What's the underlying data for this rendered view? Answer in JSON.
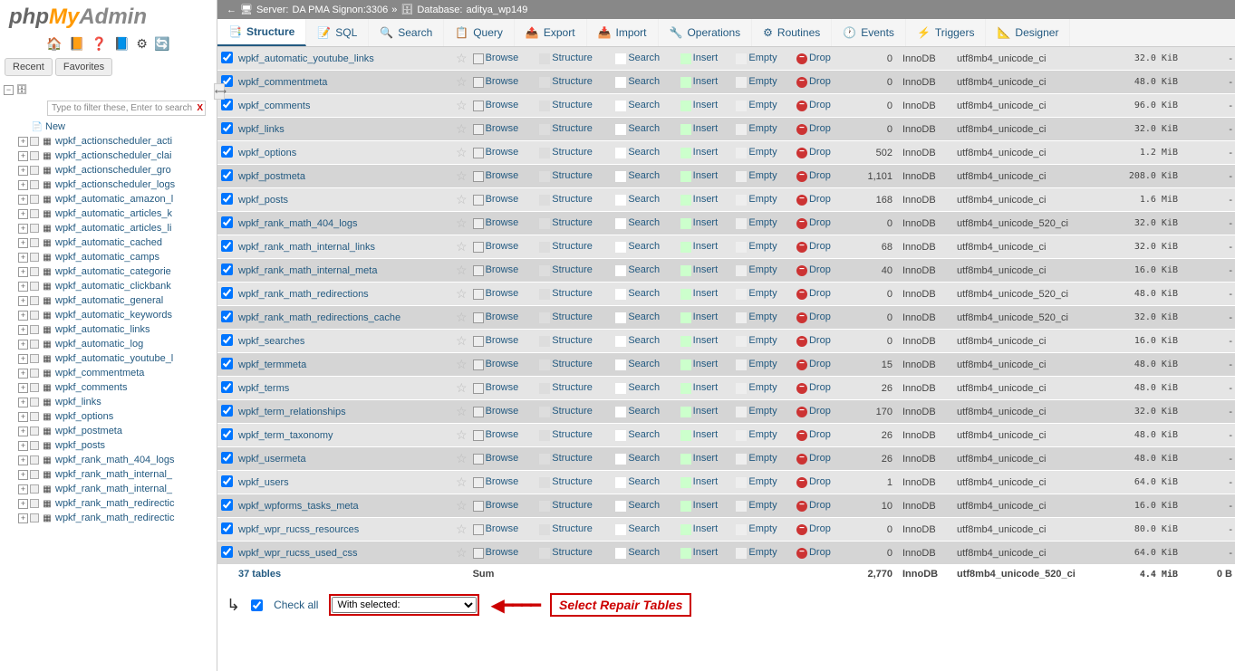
{
  "logo": {
    "php": "php",
    "my": "My",
    "admin": "Admin"
  },
  "sidebar_tabs": {
    "recent": "Recent",
    "favorites": "Favorites"
  },
  "filter_placeholder": "Type to filter these, Enter to search",
  "tree_new": "New",
  "tree_items": [
    "wpkf_actionscheduler_acti",
    "wpkf_actionscheduler_clai",
    "wpkf_actionscheduler_gro",
    "wpkf_actionscheduler_logs",
    "wpkf_automatic_amazon_l",
    "wpkf_automatic_articles_k",
    "wpkf_automatic_articles_li",
    "wpkf_automatic_cached",
    "wpkf_automatic_camps",
    "wpkf_automatic_categorie",
    "wpkf_automatic_clickbank",
    "wpkf_automatic_general",
    "wpkf_automatic_keywords",
    "wpkf_automatic_links",
    "wpkf_automatic_log",
    "wpkf_automatic_youtube_l",
    "wpkf_commentmeta",
    "wpkf_comments",
    "wpkf_links",
    "wpkf_options",
    "wpkf_postmeta",
    "wpkf_posts",
    "wpkf_rank_math_404_logs",
    "wpkf_rank_math_internal_",
    "wpkf_rank_math_internal_",
    "wpkf_rank_math_redirectic",
    "wpkf_rank_math_redirectic"
  ],
  "breadcrumb": {
    "server_label": "Server:",
    "server": "DA PMA Signon:3306",
    "db_label": "Database:",
    "db": "aditya_wp149"
  },
  "tabs": [
    "Structure",
    "SQL",
    "Search",
    "Query",
    "Export",
    "Import",
    "Operations",
    "Routines",
    "Events",
    "Triggers",
    "Designer"
  ],
  "actions": {
    "browse": "Browse",
    "structure": "Structure",
    "search": "Search",
    "insert": "Insert",
    "empty": "Empty",
    "drop": "Drop"
  },
  "tables": [
    {
      "name": "wpkf_automatic_youtube_links",
      "rows": "0",
      "engine": "InnoDB",
      "collation": "utf8mb4_unicode_ci",
      "size": "32.0 KiB",
      "overhead": "-"
    },
    {
      "name": "wpkf_commentmeta",
      "rows": "0",
      "engine": "InnoDB",
      "collation": "utf8mb4_unicode_ci",
      "size": "48.0 KiB",
      "overhead": "-"
    },
    {
      "name": "wpkf_comments",
      "rows": "0",
      "engine": "InnoDB",
      "collation": "utf8mb4_unicode_ci",
      "size": "96.0 KiB",
      "overhead": "-"
    },
    {
      "name": "wpkf_links",
      "rows": "0",
      "engine": "InnoDB",
      "collation": "utf8mb4_unicode_ci",
      "size": "32.0 KiB",
      "overhead": "-"
    },
    {
      "name": "wpkf_options",
      "rows": "502",
      "engine": "InnoDB",
      "collation": "utf8mb4_unicode_ci",
      "size": "1.2 MiB",
      "overhead": "-"
    },
    {
      "name": "wpkf_postmeta",
      "rows": "1,101",
      "engine": "InnoDB",
      "collation": "utf8mb4_unicode_ci",
      "size": "208.0 KiB",
      "overhead": "-"
    },
    {
      "name": "wpkf_posts",
      "rows": "168",
      "engine": "InnoDB",
      "collation": "utf8mb4_unicode_ci",
      "size": "1.6 MiB",
      "overhead": "-"
    },
    {
      "name": "wpkf_rank_math_404_logs",
      "rows": "0",
      "engine": "InnoDB",
      "collation": "utf8mb4_unicode_520_ci",
      "size": "32.0 KiB",
      "overhead": "-"
    },
    {
      "name": "wpkf_rank_math_internal_links",
      "rows": "68",
      "engine": "InnoDB",
      "collation": "utf8mb4_unicode_ci",
      "size": "32.0 KiB",
      "overhead": "-"
    },
    {
      "name": "wpkf_rank_math_internal_meta",
      "rows": "40",
      "engine": "InnoDB",
      "collation": "utf8mb4_unicode_ci",
      "size": "16.0 KiB",
      "overhead": "-"
    },
    {
      "name": "wpkf_rank_math_redirections",
      "rows": "0",
      "engine": "InnoDB",
      "collation": "utf8mb4_unicode_520_ci",
      "size": "48.0 KiB",
      "overhead": "-"
    },
    {
      "name": "wpkf_rank_math_redirections_cache",
      "rows": "0",
      "engine": "InnoDB",
      "collation": "utf8mb4_unicode_520_ci",
      "size": "32.0 KiB",
      "overhead": "-"
    },
    {
      "name": "wpkf_searches",
      "rows": "0",
      "engine": "InnoDB",
      "collation": "utf8mb4_unicode_ci",
      "size": "16.0 KiB",
      "overhead": "-"
    },
    {
      "name": "wpkf_termmeta",
      "rows": "15",
      "engine": "InnoDB",
      "collation": "utf8mb4_unicode_ci",
      "size": "48.0 KiB",
      "overhead": "-"
    },
    {
      "name": "wpkf_terms",
      "rows": "26",
      "engine": "InnoDB",
      "collation": "utf8mb4_unicode_ci",
      "size": "48.0 KiB",
      "overhead": "-"
    },
    {
      "name": "wpkf_term_relationships",
      "rows": "170",
      "engine": "InnoDB",
      "collation": "utf8mb4_unicode_ci",
      "size": "32.0 KiB",
      "overhead": "-"
    },
    {
      "name": "wpkf_term_taxonomy",
      "rows": "26",
      "engine": "InnoDB",
      "collation": "utf8mb4_unicode_ci",
      "size": "48.0 KiB",
      "overhead": "-"
    },
    {
      "name": "wpkf_usermeta",
      "rows": "26",
      "engine": "InnoDB",
      "collation": "utf8mb4_unicode_ci",
      "size": "48.0 KiB",
      "overhead": "-"
    },
    {
      "name": "wpkf_users",
      "rows": "1",
      "engine": "InnoDB",
      "collation": "utf8mb4_unicode_ci",
      "size": "64.0 KiB",
      "overhead": "-"
    },
    {
      "name": "wpkf_wpforms_tasks_meta",
      "rows": "10",
      "engine": "InnoDB",
      "collation": "utf8mb4_unicode_ci",
      "size": "16.0 KiB",
      "overhead": "-"
    },
    {
      "name": "wpkf_wpr_rucss_resources",
      "rows": "0",
      "engine": "InnoDB",
      "collation": "utf8mb4_unicode_ci",
      "size": "80.0 KiB",
      "overhead": "-"
    },
    {
      "name": "wpkf_wpr_rucss_used_css",
      "rows": "0",
      "engine": "InnoDB",
      "collation": "utf8mb4_unicode_ci",
      "size": "64.0 KiB",
      "overhead": "-"
    }
  ],
  "summary": {
    "label": "37 tables",
    "sum": "Sum",
    "rows": "2,770",
    "engine": "InnoDB",
    "collation": "utf8mb4_unicode_520_ci",
    "size": "4.4 MiB",
    "overhead": "0 B"
  },
  "footer": {
    "checkall": "Check all",
    "with_selected": "With selected:",
    "callout": "Select Repair Tables"
  }
}
